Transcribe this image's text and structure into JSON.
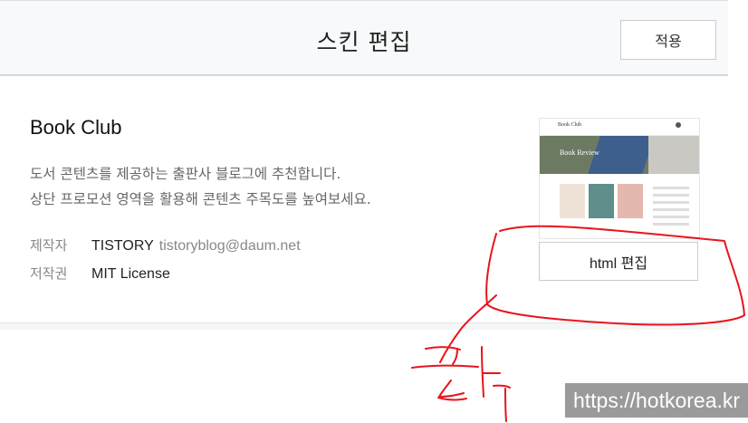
{
  "header": {
    "title": "스킨 편집",
    "apply_label": "적용"
  },
  "skin": {
    "name": "Book Club",
    "description": [
      "도서 콘텐츠를 제공하는 출판사 블로그에 추천합니다.",
      "상단 프로모션 영역을 활용해 콘텐츠 주목도를 높여보세요."
    ],
    "author_label": "제작자",
    "author": "TISTORY",
    "author_email": "tistoryblog@daum.net",
    "license_label": "저작권",
    "license": "MIT License",
    "html_edit_label": "html 편집",
    "thumbnail": {
      "logo": "Book Club",
      "hero_text": "Book Review"
    }
  },
  "annotation": {
    "handwritten_text": "클릭",
    "color": "#e8141c"
  },
  "watermark": "https://hotkorea.kr"
}
